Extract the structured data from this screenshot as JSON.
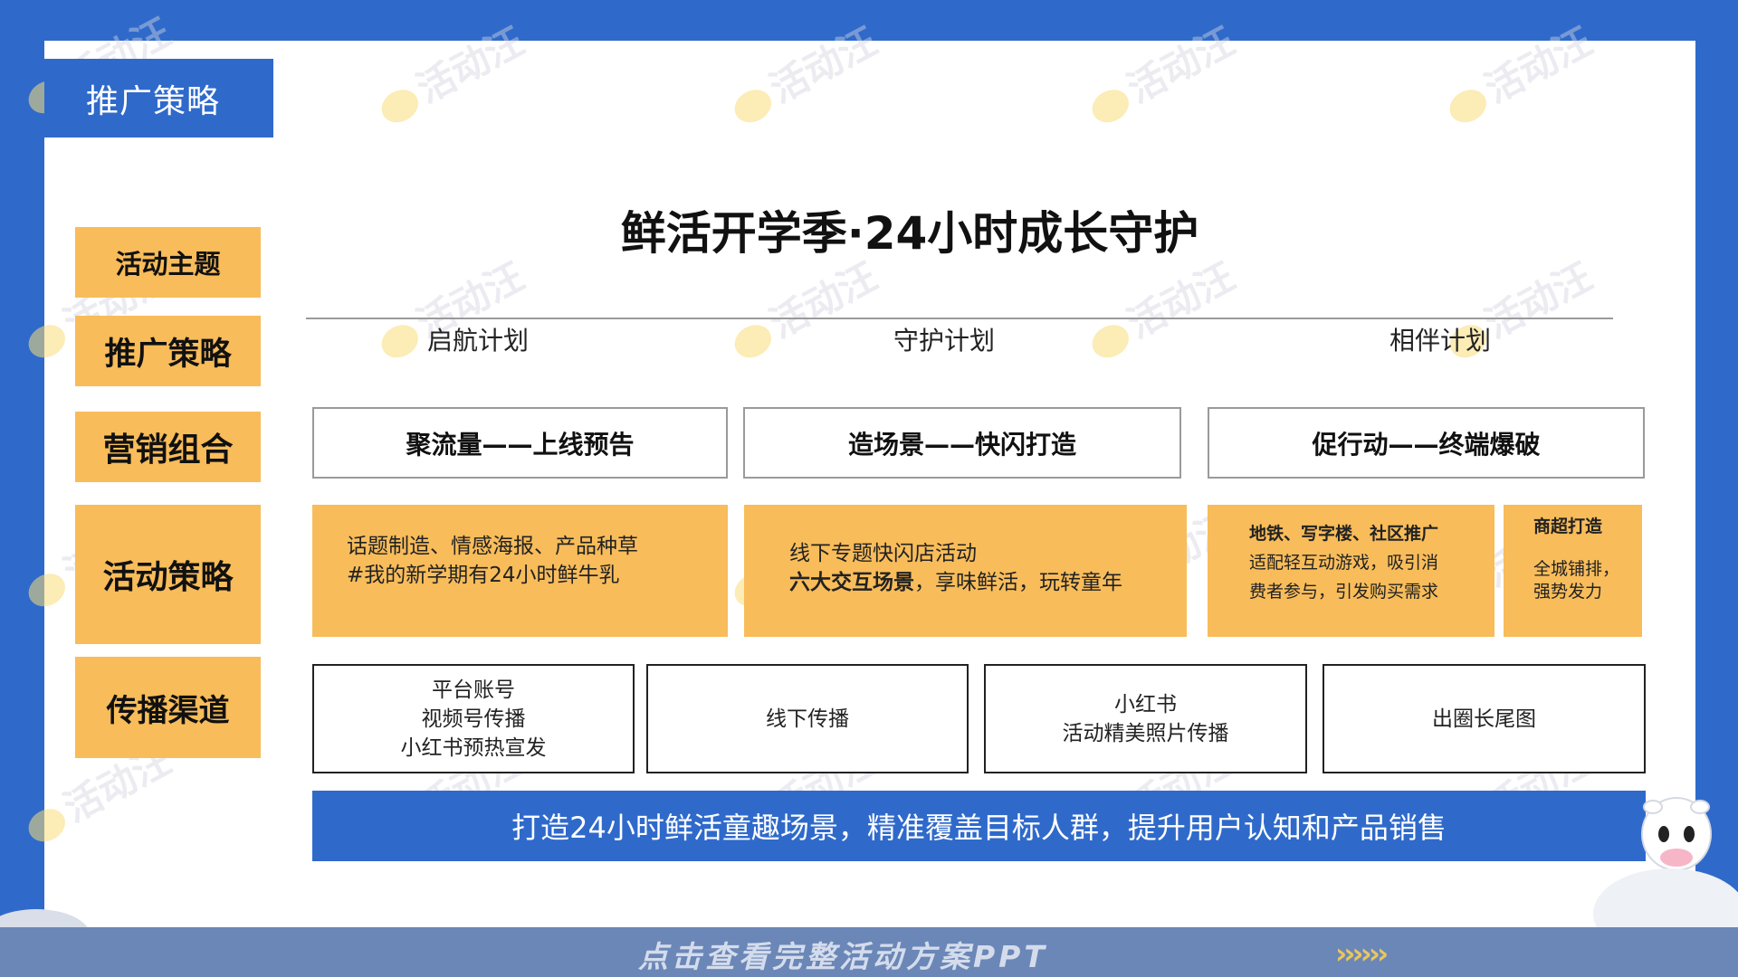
{
  "header": {
    "title": "推广策略"
  },
  "side_tabs": [
    {
      "label": "活动主题"
    },
    {
      "label": "推广策略"
    },
    {
      "label": "营销组合"
    },
    {
      "label": "活动策略"
    },
    {
      "label": "传播渠道"
    }
  ],
  "main_title": "鲜活开学季·24小时成长守护",
  "phases": [
    {
      "label": "启航计划"
    },
    {
      "label": "守护计划"
    },
    {
      "label": "相伴计划"
    }
  ],
  "marketing": [
    {
      "label": "聚流量——上线预告"
    },
    {
      "label": "造场景——快闪打造"
    },
    {
      "label": "促行动——终端爆破"
    }
  ],
  "activities": {
    "a1": {
      "line1": "话题制造、情感海报、产品种草",
      "line2": "#我的新学期有24小时鲜牛乳"
    },
    "a2": {
      "line1": "线下专题快闪店活动",
      "line2_bold": "六大交互场景",
      "line2_rest": "，享味鲜活，玩转童年"
    },
    "a3": {
      "title": "地铁、写字楼、社区推广",
      "line1": "适配轻互动游戏，吸引消",
      "line2": "费者参与，引发购买需求"
    },
    "a4": {
      "title": "商超打造",
      "line1": "全城铺排，",
      "line2": "强势发力"
    }
  },
  "channels": [
    {
      "lines": [
        "平台账号",
        "视频号传播",
        "小红书预热宣发"
      ]
    },
    {
      "lines": [
        "线下传播"
      ]
    },
    {
      "lines": [
        "小红书",
        "活动精美照片传播"
      ]
    },
    {
      "lines": [
        "出圈长尾图"
      ]
    }
  ],
  "banner": "打造24小时鲜活童趣场景，精准覆盖目标人群，提升用户认知和产品销售",
  "footer": {
    "cta": "点击查看完整活动方案PPT",
    "arrows": "››››››"
  },
  "watermark": "活动汪",
  "colors": {
    "primary_blue": "#2F6ACB",
    "accent_yellow": "#F8BC5A",
    "footer_blue": "#6B87B7"
  }
}
